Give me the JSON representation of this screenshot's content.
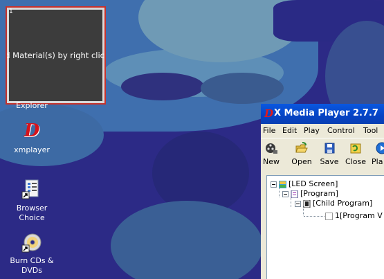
{
  "desktop": {
    "preview_panel": {
      "number": "1",
      "message": "d Material(s) by right clic"
    },
    "icons": [
      {
        "label": "Explorer",
        "icon": "explorer-icon"
      },
      {
        "label": "xmplayer",
        "icon": "xmplayer-icon"
      },
      {
        "label": "Browser Choice",
        "icon": "browser-choice-icon"
      },
      {
        "label": "Burn CDs & DVDs",
        "icon": "burn-cd-icon"
      }
    ]
  },
  "window": {
    "title": "X Media Player 2.7.7",
    "menu": [
      "File",
      "Edit",
      "Play",
      "Control",
      "Tool"
    ],
    "toolbar": [
      {
        "label": "New",
        "icon": "film-reel-icon"
      },
      {
        "label": "Open",
        "icon": "open-folder-icon"
      },
      {
        "label": "Save",
        "icon": "save-disk-icon"
      },
      {
        "label": "Close",
        "icon": "close-folder-icon"
      },
      {
        "label": "Pla",
        "icon": "play-icon"
      }
    ],
    "tree": [
      {
        "label": "[LED Screen]",
        "icon": "led-screen-icon"
      },
      {
        "label": "[Program]",
        "icon": "program-icon"
      },
      {
        "label": "[Child Program]",
        "icon": "child-program-icon"
      },
      {
        "label": "1[Program V",
        "icon": "program-window-icon"
      }
    ]
  },
  "colors": {
    "desktop_bg": "#2c2a86",
    "titlebar": "#0543c4",
    "preview_border": "#c8322b"
  }
}
